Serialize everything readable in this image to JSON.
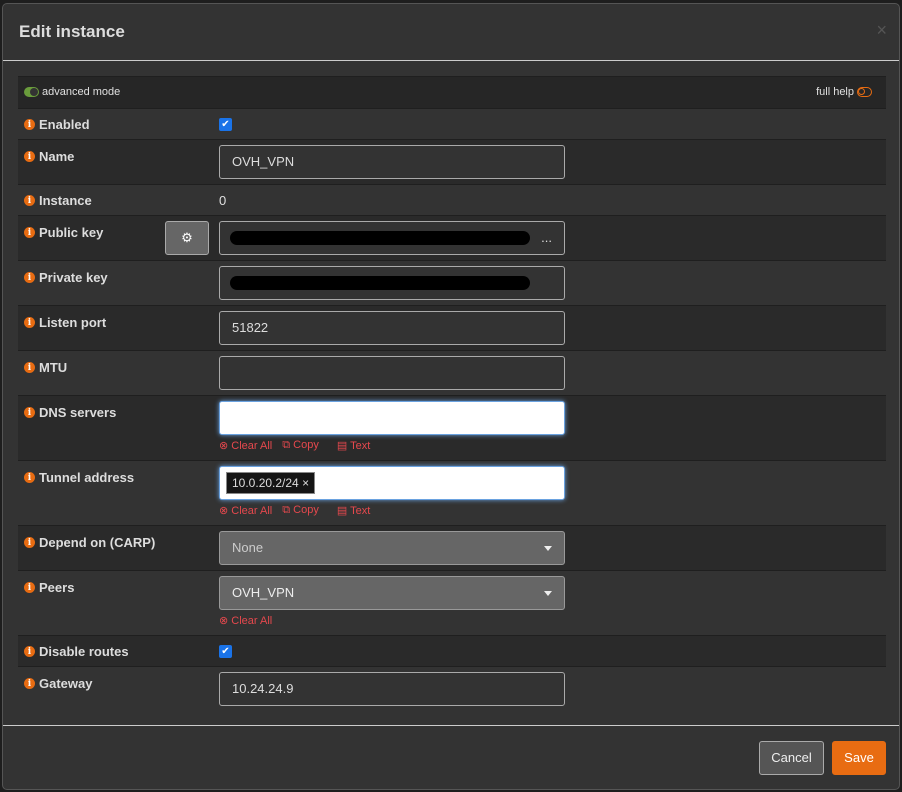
{
  "modal": {
    "title": "Edit instance",
    "close": "×"
  },
  "toolbar": {
    "advanced_mode": "advanced mode",
    "full_help": "full help"
  },
  "fields": {
    "enabled": {
      "label": "Enabled",
      "checked": true
    },
    "name": {
      "label": "Name",
      "value": "OVH_VPN"
    },
    "instance": {
      "label": "Instance",
      "value": "0"
    },
    "public_key": {
      "label": "Public key",
      "ellipsis": "..."
    },
    "private_key": {
      "label": "Private key"
    },
    "listen_port": {
      "label": "Listen port",
      "value": "51822"
    },
    "mtu": {
      "label": "MTU",
      "value": ""
    },
    "dns_servers": {
      "label": "DNS servers",
      "value": ""
    },
    "tunnel_address": {
      "label": "Tunnel address",
      "tag": "10.0.20.2/24",
      "tag_remove": "×"
    },
    "depend_on": {
      "label": "Depend on (CARP)",
      "value": "None"
    },
    "peers": {
      "label": "Peers",
      "value": "OVH_VPN"
    },
    "disable_routes": {
      "label": "Disable routes",
      "checked": true
    },
    "gateway": {
      "label": "Gateway",
      "value": "10.24.24.9"
    }
  },
  "links": {
    "clear_all": "Clear All",
    "copy": "Copy",
    "text": "Text"
  },
  "footer": {
    "cancel": "Cancel",
    "save": "Save"
  },
  "colors": {
    "accent": "#e86c12",
    "link": "#e5484d",
    "save": "#e86c12"
  }
}
